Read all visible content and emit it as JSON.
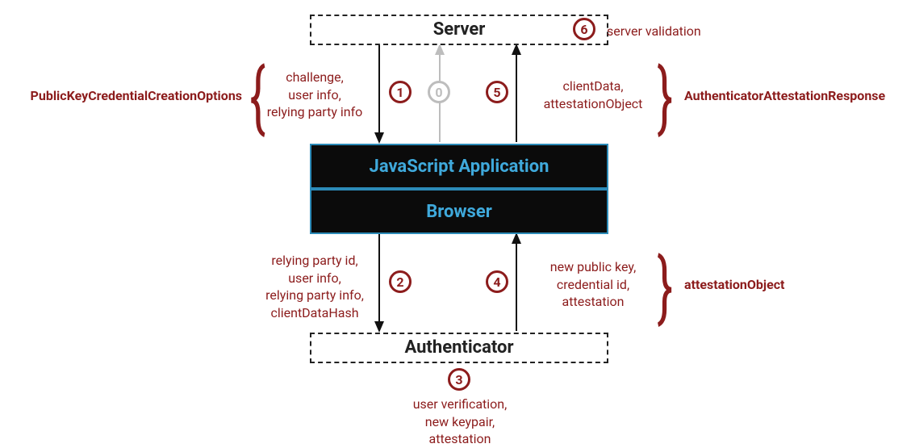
{
  "boxes": {
    "server": {
      "title": "Server"
    },
    "jsapp": {
      "title": "JavaScript Application"
    },
    "browser": {
      "title": "Browser"
    },
    "auth": {
      "title": "Authenticator"
    }
  },
  "steps": {
    "zero_label": "0",
    "s1_label": "1",
    "s2_label": "2",
    "s3_label": "3",
    "s4_label": "4",
    "s5_label": "5",
    "s6_label": "6"
  },
  "labels": {
    "pkcco": "PublicKeyCredentialCreationOptions",
    "aar": "AuthenticatorAttestationResponse",
    "server_validation": "server validation",
    "attestationObject": "attestationObject",
    "step1_lines": [
      "challenge,",
      "user info,",
      "relying party info"
    ],
    "step5_lines": [
      "clientData,",
      "attestationObject"
    ],
    "step2_lines": [
      "relying party id,",
      "user info,",
      "relying party info,",
      "clientDataHash"
    ],
    "step4_lines": [
      "new public key,",
      "credential id,",
      "attestation"
    ],
    "step3_lines": [
      "user verification,",
      "new keypair,",
      "attestation"
    ]
  }
}
